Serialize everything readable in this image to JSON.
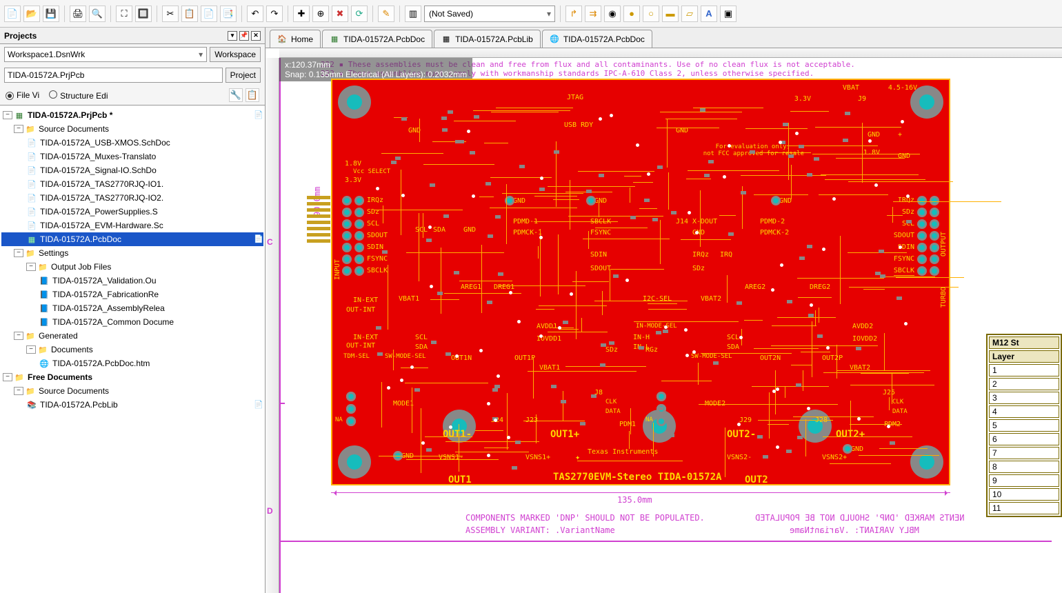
{
  "toolbar": {
    "save_state": "(Not Saved)"
  },
  "panel": {
    "title": "Projects",
    "workspace_value": "Workspace1.DsnWrk",
    "workspace_btn": "Workspace",
    "project_value": "TIDA-01572A.PrjPcb",
    "project_btn": "Project",
    "view_file": "File Vi",
    "view_struct": "Structure Edi"
  },
  "tree": {
    "root": "TIDA-01572A.PrjPcb *",
    "source_hdr": "Source Documents",
    "src": [
      "TIDA-01572A_USB-XMOS.SchDoc",
      "TIDA-01572A_Muxes-Translato",
      "TIDA-01572A_Signal-IO.SchDo",
      "TIDA-01572A_TAS2770RJQ-IO1.",
      "TIDA-01572A_TAS2770RJQ-IO2.",
      "TIDA-01572A_PowerSupplies.S",
      "TIDA-01572A_EVM-Hardware.Sc"
    ],
    "src_sel": "TIDA-01572A.PcbDoc",
    "settings_hdr": "Settings",
    "outjob_hdr": "Output Job Files",
    "outjobs": [
      "TIDA-01572A_Validation.Ou",
      "TIDA-01572A_FabricationRe",
      "TIDA-01572A_AssemblyRelea",
      "TIDA-01572A_Common Docume"
    ],
    "generated_hdr": "Generated",
    "gendoc_hdr": "Documents",
    "gendoc": "TIDA-01572A.PcbDoc.htm",
    "free_hdr": "Free Documents",
    "free_src_hdr": "Source Documents",
    "free_doc": "TIDA-01572A.PcbLib"
  },
  "tabs": [
    {
      "icon": "🏠",
      "label": "Home"
    },
    {
      "icon": "▦",
      "label": "TIDA-01572A.PcbDoc"
    },
    {
      "icon": "▦",
      "label": "TIDA-01572A.PcbLib"
    },
    {
      "icon": "🌐",
      "label": "TIDA-01572A.PcbDoc"
    }
  ],
  "sheet": {
    "note1": "222 ▪ These assemblies must be clean and free from flux and all contaminants. Use of no clean flux is not acceptable.",
    "note2": "223 ▪ These assemblies must comply with workmanship standards IPC-A-610 Class 2, unless otherwise specified.",
    "ruler_c": "C",
    "ruler_d": "D",
    "dim_w": "135.0mm",
    "dim_h": "90.0mm"
  },
  "cursor": {
    "pos": "x:120.37mm",
    "snap": "Snap: 0.135mm Electrical (All Layers): 0.2032mm"
  },
  "board": {
    "title": "TAS2770EVM-Stereo  TIDA-01572A",
    "brand": "Texas Instruments",
    "eval_note1": "For evaluation only;",
    "eval_note2": "not FCC approved for resale",
    "vbat": "VBAT",
    "vrange": "4.5-16V",
    "v33": "3.3V",
    "jtag": "JTAG",
    "usb_rdy": "USB RDY",
    "v18": "1.8V",
    "vcc_sel": "Vcc SELECT",
    "v33b": "3.3V",
    "v8": "1.8V",
    "input": "INPUT",
    "output": "OUTPUT",
    "turbo": "TURBO",
    "irqz": "IRQz",
    "sdz": "SDz",
    "scl": "SCL",
    "sdout": "SDOUT",
    "sdin": "SDIN",
    "fsync": "FSYNC",
    "sbclk": "SBCLK",
    "sda": "SDA",
    "pdmd1": "PDMD-1",
    "pdmck1": "PDMCK-1",
    "pdmd2": "PDMD-2",
    "pdmck2": "PDMCK-2",
    "xdout": "X-DOUT",
    "eirq": "IRQ",
    "areg1": "AREG1",
    "dreg1": "DREG1",
    "areg2": "AREG2",
    "dreg2": "DREG2",
    "vbat1": "VBAT1",
    "vbat2": "VBAT2",
    "inext": "IN-EXT",
    "outint": "OUT-INT",
    "i2csel": "I2C-SEL",
    "avdd1": "AVDD1",
    "iovdd1": "IOVDD1",
    "avdd2": "AVDD2",
    "iovdd2": "IOVDD2",
    "swmode": "SW-MODE-SEL",
    "tdmsel": "TDM-SEL",
    "inmode": "IN-MODE-SEL",
    "out1n": "OUT1N",
    "out1p": "OUT1P",
    "out2n": "OUT2N",
    "out2p": "OUT2P",
    "inh": "IN-H",
    "inl": "IN-L",
    "rgz": "RGz",
    "mode1": "MODE1",
    "mode2": "MODE2",
    "j24": "J24",
    "j23": "J23",
    "j29": "J29",
    "j28": "J28",
    "j25": "J25",
    "j9": "J9",
    "j14": "J14",
    "j8": "J8",
    "clk": "CLK",
    "data": "DATA",
    "pdm1": "PDM1",
    "pdm2": "PDM2",
    "na": "NA",
    "out1m": "OUT1-",
    "out1pp": "OUT1+",
    "out2m": "OUT2-",
    "out2pp": "OUT2+",
    "out1": "OUT1",
    "out2": "OUT2",
    "vsns1m": "VSNS1-",
    "vsns1p": "VSNS1+",
    "vsns2m": "VSNS2-",
    "vsns2p": "VSNS2+",
    "gnd": "GND",
    "plus": "+"
  },
  "footer": {
    "line1": "COMPONENTS MARKED 'DNP' SHOULD NOT BE POPULATED.",
    "line2": "ASSEMBLY VARIANT: .VariantName",
    "mirror1": "NENTS MARKED 'DNP' SHOULD NOT BE POPULATED",
    "mirror2": "MBLY VARIANT: .VariantName"
  },
  "legend": {
    "title": "M12 St",
    "col": "Layer",
    "rows": [
      "1",
      "2",
      "3",
      "4",
      "5",
      "6",
      "7",
      "8",
      "9",
      "10",
      "11"
    ]
  }
}
